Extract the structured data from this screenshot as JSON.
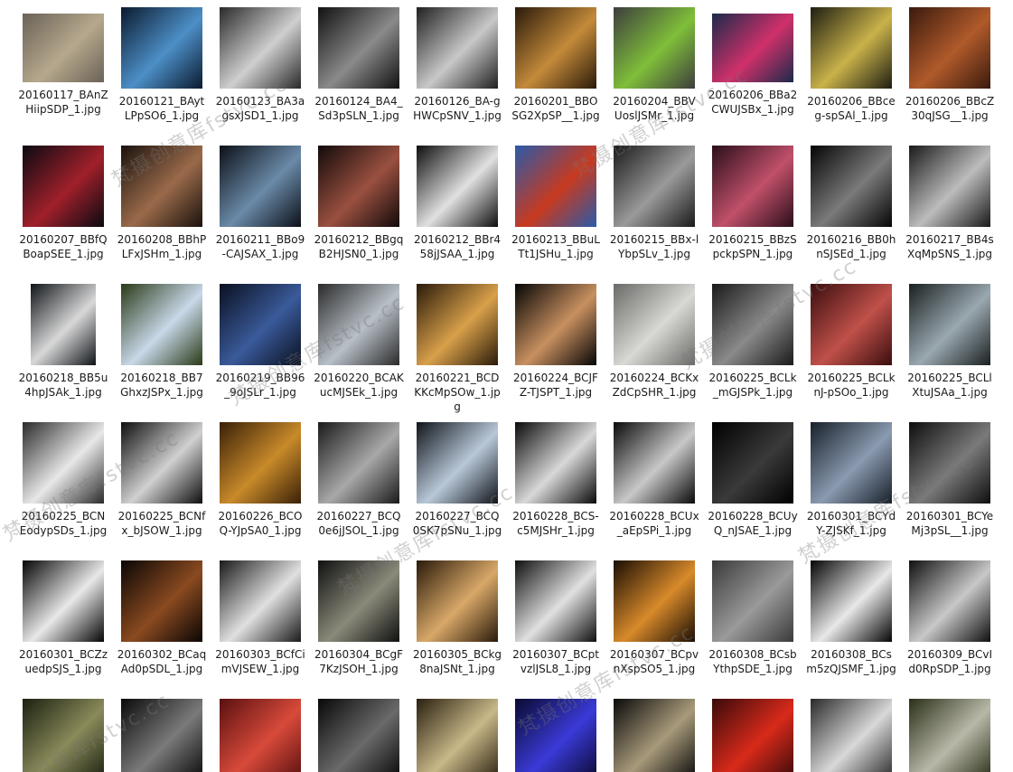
{
  "files": [
    {
      "name": "20160117_BAnZHiipSDP_1.jpg",
      "colors": [
        "#6a6257",
        "#b6a88d"
      ],
      "shape": "land"
    },
    {
      "name": "20160121_BAytLPpSO6_1.jpg",
      "colors": [
        "#0b1a2e",
        "#4c8fc7"
      ],
      "shape": "sq"
    },
    {
      "name": "20160123_BA3agsxJSD1_1.jpg",
      "colors": [
        "#2a2a2a",
        "#cfcfcf"
      ],
      "shape": "sq"
    },
    {
      "name": "20160124_BA4_Sd3pSLN_1.jpg",
      "colors": [
        "#111111",
        "#8a8a8a"
      ],
      "shape": "sq"
    },
    {
      "name": "20160126_BA-gHWCpSNV_1.jpg",
      "colors": [
        "#202020",
        "#c8c8c8"
      ],
      "shape": "sq"
    },
    {
      "name": "20160201_BBOSG2XpSP__1.jpg",
      "colors": [
        "#2a1a0a",
        "#c48a3a"
      ],
      "shape": "sq"
    },
    {
      "name": "20160204_BBVUoslJSMr_1.jpg",
      "colors": [
        "#3d3d3d",
        "#7fbf3a"
      ],
      "shape": "sq"
    },
    {
      "name": "20160206_BBa2CWUJSBx_1.jpg",
      "colors": [
        "#1b2a4a",
        "#d0306a"
      ],
      "shape": "land"
    },
    {
      "name": "20160206_BBceg-spSAl_1.jpg",
      "colors": [
        "#1e1e12",
        "#c9b24a"
      ],
      "shape": "sq"
    },
    {
      "name": "20160206_BBcZ30qJSG__1.jpg",
      "colors": [
        "#3a1a0e",
        "#b05a2a"
      ],
      "shape": "sq"
    },
    {
      "name": "20160207_BBfQBoapSEE_1.jpg",
      "colors": [
        "#0a0a12",
        "#a0202a"
      ],
      "shape": "sq"
    },
    {
      "name": "20160208_BBhPLFxJSHm_1.jpg",
      "colors": [
        "#1a120e",
        "#9a6a4a"
      ],
      "shape": "sq"
    },
    {
      "name": "20160211_BBo9-CAJSAX_1.jpg",
      "colors": [
        "#0c1018",
        "#6a8aa8"
      ],
      "shape": "sq"
    },
    {
      "name": "20160212_BBgqB2HJSN0_1.jpg",
      "colors": [
        "#120a0a",
        "#9a5040"
      ],
      "shape": "sq"
    },
    {
      "name": "20160212_BBr458jJSAA_1.jpg",
      "colors": [
        "#0e0e0e",
        "#e0e0e0"
      ],
      "shape": "sq"
    },
    {
      "name": "20160213_BBuLTt1JSHu_1.jpg",
      "colors": [
        "#2a5aa8",
        "#c83a20"
      ],
      "shape": "sq"
    },
    {
      "name": "20160215_BBx-lYbpSLv_1.jpg",
      "colors": [
        "#1a1a1a",
        "#9a9a9a"
      ],
      "shape": "sq"
    },
    {
      "name": "20160215_BBzSpckpSPN_1.jpg",
      "colors": [
        "#2a0e1a",
        "#c0506a"
      ],
      "shape": "sq"
    },
    {
      "name": "20160216_BB0hnSJSEd_1.jpg",
      "colors": [
        "#050505",
        "#7a7a7a"
      ],
      "shape": "sq"
    },
    {
      "name": "20160217_BB4sXqMpSNS_1.jpg",
      "colors": [
        "#1a1a1a",
        "#bcbcbc"
      ],
      "shape": "sq"
    },
    {
      "name": "20160218_BB5u4hpJSAk_1.jpg",
      "colors": [
        "#101418",
        "#d8d8d8"
      ],
      "shape": "port"
    },
    {
      "name": "20160218_BB7GhxzJSPx_1.jpg",
      "colors": [
        "#2a3a18",
        "#c8d8e8"
      ],
      "shape": "sq"
    },
    {
      "name": "20160219_BB96_9oJSLr_1.jpg",
      "colors": [
        "#0a1020",
        "#3a5a9a"
      ],
      "shape": "sq"
    },
    {
      "name": "20160220_BCAKucMJSEk_1.jpg",
      "colors": [
        "#2a2a2a",
        "#b8c0c8"
      ],
      "shape": "sq"
    },
    {
      "name": "20160221_BCDKKcMpSOw_1.jpg",
      "colors": [
        "#2a1a0a",
        "#d8a04a"
      ],
      "shape": "sq"
    },
    {
      "name": "20160224_BCJFZ-TJSPT_1.jpg",
      "colors": [
        "#050505",
        "#c89060"
      ],
      "shape": "sq"
    },
    {
      "name": "20160224_BCKxZdCpSHR_1.jpg",
      "colors": [
        "#6a6a68",
        "#d8d8d4"
      ],
      "shape": "sq"
    },
    {
      "name": "20160225_BCLk_mGJSPk_1.jpg",
      "colors": [
        "#1a1a1a",
        "#8a8a8a"
      ],
      "shape": "sq"
    },
    {
      "name": "20160225_BCLknJ-pSOo_1.jpg",
      "colors": [
        "#3a0e0e",
        "#c0504a"
      ],
      "shape": "sq"
    },
    {
      "name": "20160225_BCLlXtuJSAa_1.jpg",
      "colors": [
        "#1a2020",
        "#9aa8b0"
      ],
      "shape": "sq"
    },
    {
      "name": "20160225_BCNEodypSDs_1.jpg",
      "colors": [
        "#2a2a2a",
        "#e8e8e8"
      ],
      "shape": "sq"
    },
    {
      "name": "20160225_BCNfx_bJSOW_1.jpg",
      "colors": [
        "#0e0e0e",
        "#d0d0d0"
      ],
      "shape": "sq"
    },
    {
      "name": "20160226_BCOQ-YJpSA0_1.jpg",
      "colors": [
        "#3a2008",
        "#c88a2a"
      ],
      "shape": "sq"
    },
    {
      "name": "20160227_BCQ0e6jJSOL_1.jpg",
      "colors": [
        "#1a1a1a",
        "#a8a8a8"
      ],
      "shape": "sq"
    },
    {
      "name": "20160227_BCQ0SK7pSNu_1.jpg",
      "colors": [
        "#10141a",
        "#b8c8d8"
      ],
      "shape": "sq"
    },
    {
      "name": "20160228_BCS-c5MJSHr_1.jpg",
      "colors": [
        "#0a0a0a",
        "#d8d8d8"
      ],
      "shape": "sq"
    },
    {
      "name": "20160228_BCUx_aEpSPi_1.jpg",
      "colors": [
        "#0a0a0a",
        "#c8c8c8"
      ],
      "shape": "sq"
    },
    {
      "name": "20160228_BCUyQ_nJSAE_1.jpg",
      "colors": [
        "#000000",
        "#3a3a3a"
      ],
      "shape": "sq"
    },
    {
      "name": "20160301_BCYdY-ZJSKf_1.jpg",
      "colors": [
        "#18202a",
        "#8a9ab0"
      ],
      "shape": "sq"
    },
    {
      "name": "20160301_BCYeMj3pSL__1.jpg",
      "colors": [
        "#0e0e0e",
        "#7a7a7a"
      ],
      "shape": "sq"
    },
    {
      "name": "20160301_BCZzuedpSJS_1.jpg",
      "colors": [
        "#050505",
        "#e8e8e8"
      ],
      "shape": "sq"
    },
    {
      "name": "20160302_BCaqAd0pSDL_1.jpg",
      "colors": [
        "#0a0605",
        "#8a4a20"
      ],
      "shape": "sq"
    },
    {
      "name": "20160303_BCfCimVJSEW_1.jpg",
      "colors": [
        "#1a1a1a",
        "#e0e0e0"
      ],
      "shape": "sq"
    },
    {
      "name": "20160304_BCgF7KzJSOH_1.jpg",
      "colors": [
        "#101010",
        "#8a8a7a"
      ],
      "shape": "sq"
    },
    {
      "name": "20160305_BCkg8naJSNt_1.jpg",
      "colors": [
        "#2a1a0a",
        "#d8a868"
      ],
      "shape": "sq"
    },
    {
      "name": "20160307_BCptvzlJSL8_1.jpg",
      "colors": [
        "#101010",
        "#e0e0e0"
      ],
      "shape": "sq"
    },
    {
      "name": "20160307_BCpvnXspSO5_1.jpg",
      "colors": [
        "#1a0e05",
        "#d88a2a"
      ],
      "shape": "sq"
    },
    {
      "name": "20160308_BCsbYthpSDE_1.jpg",
      "colors": [
        "#3a3a3a",
        "#9a9a9a"
      ],
      "shape": "sq"
    },
    {
      "name": "20160308_BCsm5zQJSMF_1.jpg",
      "colors": [
        "#050505",
        "#e8e8e8"
      ],
      "shape": "sq"
    },
    {
      "name": "20160309_BCvId0RpSDP_1.jpg",
      "colors": [
        "#101010",
        "#c8c8c8"
      ],
      "shape": "sq"
    },
    {
      "name": "",
      "colors": [
        "#1a2010",
        "#8a8a5a"
      ],
      "shape": "sq"
    },
    {
      "name": "",
      "colors": [
        "#0a0a0a",
        "#7a7a7a"
      ],
      "shape": "sq"
    },
    {
      "name": "",
      "colors": [
        "#5a1010",
        "#d84a3a"
      ],
      "shape": "sq"
    },
    {
      "name": "",
      "colors": [
        "#080808",
        "#6a6a6a"
      ],
      "shape": "sq"
    },
    {
      "name": "",
      "colors": [
        "#2a2010",
        "#c8b888"
      ],
      "shape": "sq"
    },
    {
      "name": "",
      "colors": [
        "#0a0a30",
        "#3a3ad8"
      ],
      "shape": "sq"
    },
    {
      "name": "",
      "colors": [
        "#0a0a0a",
        "#a89a7a"
      ],
      "shape": "sq"
    },
    {
      "name": "",
      "colors": [
        "#3a0a0a",
        "#d82a1a"
      ],
      "shape": "sq"
    },
    {
      "name": "",
      "colors": [
        "#2a2a2a",
        "#d8d8d8"
      ],
      "shape": "sq"
    },
    {
      "name": "",
      "colors": [
        "#2a3018",
        "#b8b8a8"
      ],
      "shape": "sq"
    }
  ],
  "watermarks": [
    {
      "text": "梵摄创意库fstvc.cc"
    },
    {
      "text": "梵摄创意库fstvc.cc"
    },
    {
      "text": "梵摄创意库fstvc.cc"
    },
    {
      "text": "梵摄创意库fstvc.cc"
    },
    {
      "text": "梵摄创意库fstvc.cc"
    },
    {
      "text": "梵摄创意库fstvc.cc"
    },
    {
      "text": "梵摄创意库fstvc.cc"
    },
    {
      "text": "梵摄创意库fstvc.cc"
    },
    {
      "text": "梵摄创意库fstvc.cc"
    }
  ]
}
